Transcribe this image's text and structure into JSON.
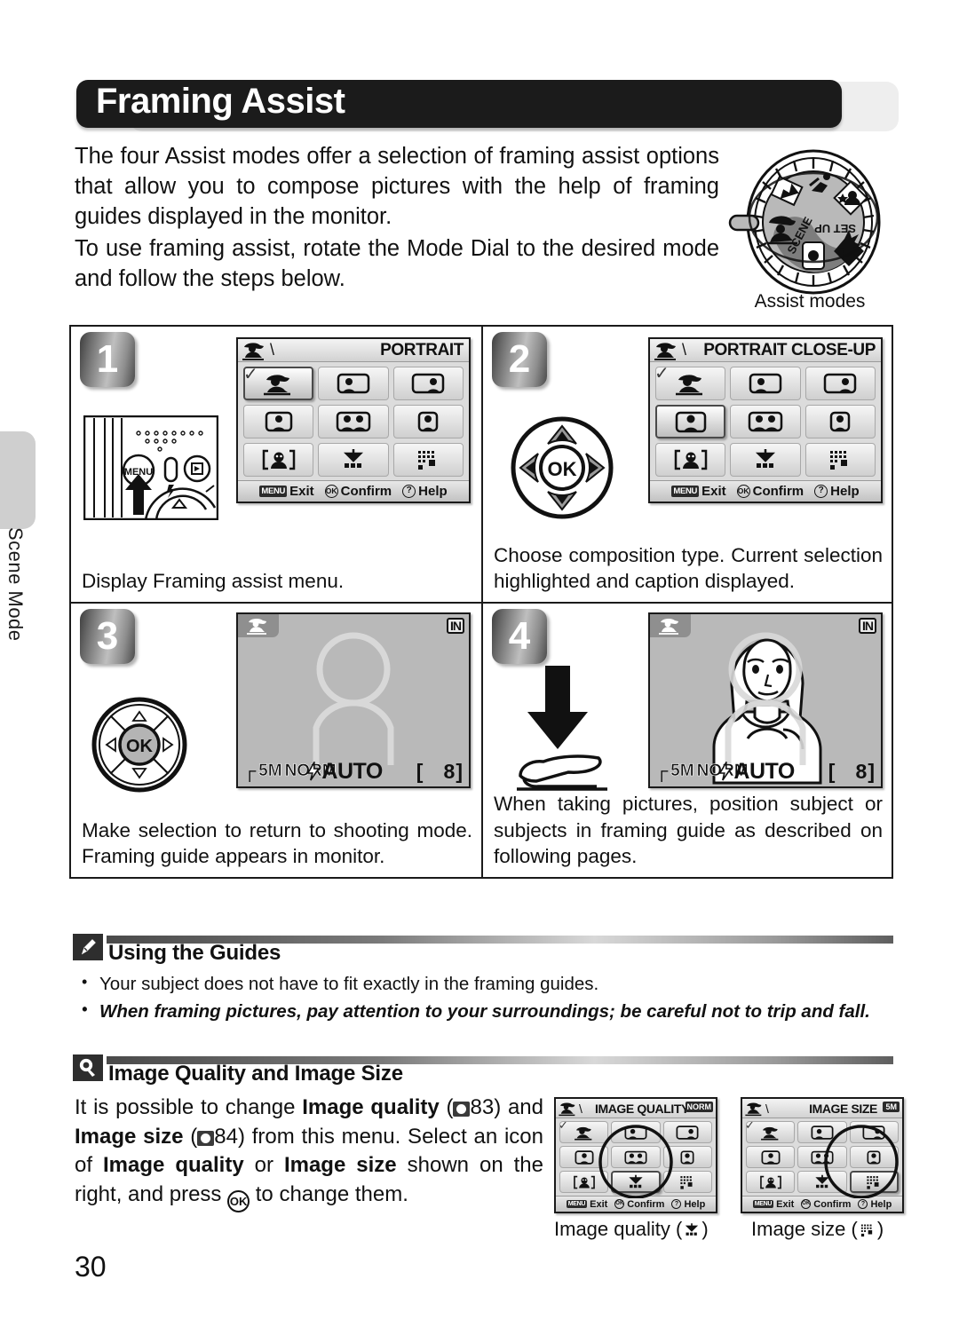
{
  "page": {
    "number": "30",
    "side_tab_label": "Scene Mode",
    "title": "Framing Assist"
  },
  "intro": {
    "paragraph1": "The four Assist modes offer a selection of framing assist options that allow you to compose pictures with the help of framing guides displayed in the monitor.",
    "paragraph2": "To use framing assist, rotate the Mode Dial to the desired mode and follow the steps below."
  },
  "mode_dial": {
    "caption": "Assist modes",
    "labels": [
      "SCENE",
      "SET UP"
    ],
    "icon_names": [
      "portrait-assist-icon",
      "party-indoor-icon",
      "night-portrait-icon",
      "landscape-assist-icon",
      "sport-assist-icon",
      "movie-icon"
    ]
  },
  "steps": [
    {
      "number": "1",
      "caption": "Display Framing assist menu.",
      "illustration": "camera-back-menu-button",
      "screen": {
        "title": "PORTRAIT",
        "mode_icon": "portrait-assist-icon",
        "selected_index": 0,
        "cells": [
          "portrait-assist-icon",
          "portrait-left-icon",
          "portrait-right-icon",
          "portrait-close-up-icon",
          "portrait-couple-icon",
          "portrait-figure-icon",
          "face-frame-icon",
          "image-quality-icon",
          "image-size-icon"
        ],
        "footer": [
          {
            "key": "MENU",
            "label": "Exit"
          },
          {
            "key": "OK",
            "label": "Confirm"
          },
          {
            "key": "?",
            "label": "Help"
          }
        ]
      }
    },
    {
      "number": "2",
      "caption": "Choose composition type. Current selection highlighted and caption displayed.",
      "illustration": "multi-selector-ok",
      "screen": {
        "title": "PORTRAIT CLOSE-UP",
        "mode_icon": "portrait-assist-icon",
        "selected_index": 3,
        "cells": [
          "portrait-assist-icon",
          "portrait-left-icon",
          "portrait-right-icon",
          "portrait-close-up-icon",
          "portrait-couple-icon",
          "portrait-figure-icon",
          "face-frame-icon",
          "image-quality-icon",
          "image-size-icon"
        ],
        "footer": [
          {
            "key": "MENU",
            "label": "Exit"
          },
          {
            "key": "OK",
            "label": "Confirm"
          },
          {
            "key": "?",
            "label": "Help"
          }
        ]
      }
    },
    {
      "number": "3",
      "caption": "Make selection to return to shooting mode. Framing guide appears in monitor.",
      "illustration": "multi-selector-ok",
      "monitor": {
        "mode_icon": "portrait-assist-icon",
        "memory_indicator": "IN",
        "image_size": "5M",
        "image_quality": "NORM",
        "flash_mode": "AUTO",
        "exposures_remaining": "8",
        "guide": "framing-guide-empty"
      }
    },
    {
      "number": "4",
      "caption": "When taking pictures, position subject or subjects in framing guide as described on following pages.",
      "illustration": "press-shutter-button",
      "monitor": {
        "mode_icon": "portrait-assist-icon",
        "memory_indicator": "IN",
        "image_size": "5M",
        "image_quality": "NORM",
        "flash_mode": "AUTO",
        "exposures_remaining": "8",
        "guide": "framing-guide-with-subject"
      }
    }
  ],
  "notes": [
    {
      "icon": "pencil-icon",
      "title": "Using the Guides",
      "bullets": [
        {
          "text": "Your subject does not have to fit exactly in the framing guides.",
          "emphasis": false
        },
        {
          "text": "When framing pictures, pay attention to your surroundings; be careful not to trip and fall.",
          "emphasis": true
        }
      ]
    },
    {
      "icon": "magnifier-icon",
      "title": "Image Quality and Image Size"
    }
  ],
  "image_quality_section": {
    "text_part1": "It is possible to change ",
    "bold1": "Image quality",
    "ref1": "83",
    "text_part2": " and ",
    "bold2": "Image size",
    "ref2": "84",
    "text_part3": " from this menu. Select an icon of ",
    "bold3": "Image quality",
    "text_part4": " or ",
    "bold4": "Image size",
    "text_part5": " shown on the right, and press ",
    "ok_key": "OK",
    "text_part6": " to change them."
  },
  "small_screens": [
    {
      "title": "IMAGE QUALITY",
      "badge": "NORM",
      "mode_icon": "portrait-assist-icon",
      "selected_index": 7,
      "caption": "Image quality",
      "caption_icon": "image-quality-icon",
      "footer": [
        {
          "key": "MENU",
          "label": "Exit"
        },
        {
          "key": "OK",
          "label": "Confirm"
        },
        {
          "key": "?",
          "label": "Help"
        }
      ]
    },
    {
      "title": "IMAGE SIZE",
      "badge": "5M",
      "mode_icon": "portrait-assist-icon",
      "selected_index": 8,
      "caption": "Image size",
      "caption_icon": "image-size-icon",
      "footer": [
        {
          "key": "MENU",
          "label": "Exit"
        },
        {
          "key": "OK",
          "label": "Confirm"
        },
        {
          "key": "?",
          "label": "Help"
        }
      ]
    }
  ],
  "colors": {
    "title_bar": "#1b1b1b",
    "lcd_body": "#dcdcdc",
    "monitor": "#b9b9b9",
    "side_tab": "#cfcfcf"
  }
}
